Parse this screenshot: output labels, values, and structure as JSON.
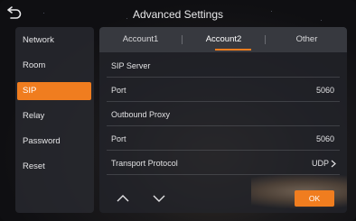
{
  "header": {
    "title": "Advanced Settings",
    "back_icon": "back-arrow-icon"
  },
  "sidebar": {
    "items": [
      {
        "label": "Network",
        "active": false
      },
      {
        "label": "Room",
        "active": false
      },
      {
        "label": "SIP",
        "active": true
      },
      {
        "label": "Relay",
        "active": false
      },
      {
        "label": "Password",
        "active": false
      },
      {
        "label": "Reset",
        "active": false
      }
    ]
  },
  "tabs": [
    {
      "label": "Account1",
      "active": false
    },
    {
      "label": "Account2",
      "active": true
    },
    {
      "label": "Other",
      "active": false
    }
  ],
  "settings": {
    "rows": [
      {
        "label": "SIP Server",
        "value": ""
      },
      {
        "label": "Port",
        "value": "5060"
      },
      {
        "label": "Outbound Proxy",
        "value": ""
      },
      {
        "label": "Port",
        "value": "5060"
      },
      {
        "label": "Transport Protocol",
        "value": "UDP"
      }
    ]
  },
  "footer": {
    "up_icon": "chevron-up-icon",
    "down_icon": "chevron-down-icon",
    "ok_label": "OK"
  },
  "colors": {
    "accent": "#f07d1f",
    "text": "#e2e2e4"
  }
}
